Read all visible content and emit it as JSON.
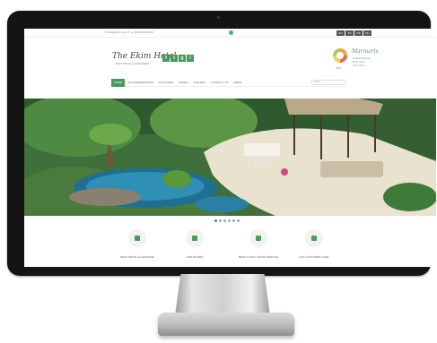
{
  "colors": {
    "accent": "#4a9a5a",
    "monitor": "#141414"
  },
  "topbar": {
    "contact": "✉ info@ekim.com  ✆ +1 (000) 000 00 00",
    "languages": [
      "EN",
      "TR",
      "DE",
      "RU"
    ]
  },
  "header": {
    "logo": "The Ekim Hotel",
    "tagline": "BEST PRICE GUARANTEED",
    "social_icons": [
      "facebook-icon",
      "twitter-icon",
      "google-plus-icon",
      "instagram-icon"
    ],
    "badge_value": "9/10",
    "weather": {
      "city": "Marmaris",
      "lines": [
        "Weather Forecast",
        "Partly Sunny",
        "28°C  |  82°F"
      ]
    }
  },
  "nav": {
    "items": [
      "HOME",
      "ACCOMMODATIONS",
      "FACILITIES",
      "TOURS",
      "GALLERY",
      "CONTACT US",
      "NEWS"
    ],
    "search_placeholder": "Search"
  },
  "slider": {
    "dot_count": 6,
    "active_index": 0
  },
  "features": [
    {
      "icon": "money-icon",
      "label": "BEST PRICE GUARANTEE"
    },
    {
      "icon": "bed-icon",
      "label": "OUR ROOMS"
    },
    {
      "icon": "service-icon",
      "label": "BEST FOOD & ROOM SERVICE"
    },
    {
      "icon": "customer-care-icon",
      "label": "24/7 CUSTOMER CARE"
    }
  ]
}
